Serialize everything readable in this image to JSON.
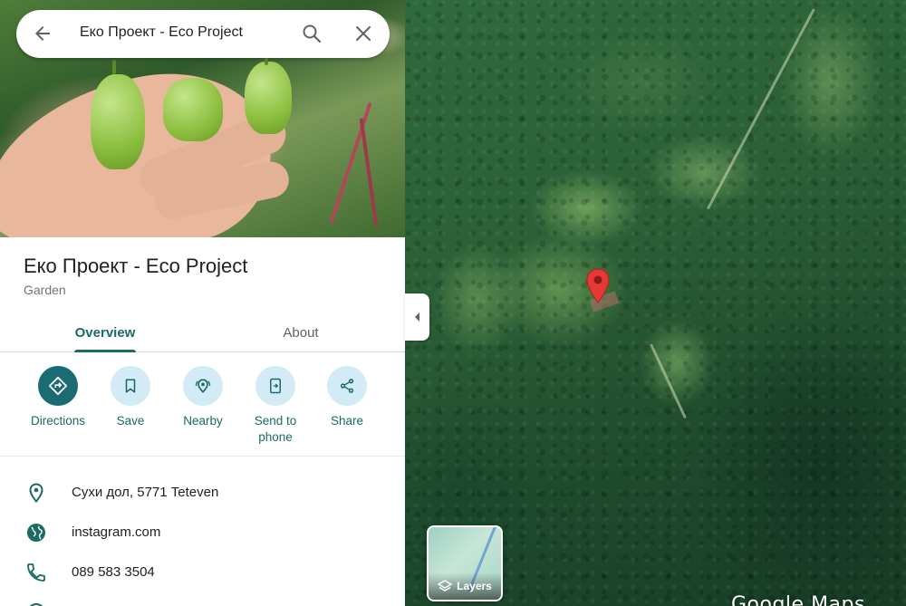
{
  "search": {
    "query": "Еко Проект - Eco Project"
  },
  "place": {
    "name": "Еко Проект - Eco Project",
    "category": "Garden"
  },
  "tabs": [
    {
      "label": "Overview",
      "active": true
    },
    {
      "label": "About",
      "active": false
    }
  ],
  "actions": [
    {
      "label": "Directions",
      "icon": "directions-icon"
    },
    {
      "label": "Save",
      "icon": "bookmark-icon"
    },
    {
      "label": "Nearby",
      "icon": "nearby-icon"
    },
    {
      "label": "Send to phone",
      "icon": "send-to-phone-icon"
    },
    {
      "label": "Share",
      "icon": "share-icon"
    }
  ],
  "info": {
    "address": "Сухи дол, 5771 Teteven",
    "website": "instagram.com",
    "phone": "089 583 3504"
  },
  "map": {
    "layers_label": "Layers",
    "logo": "Google Maps"
  },
  "colors": {
    "accent": "#1a6b63",
    "action_bg": "#d2ebf4",
    "pin": "#e53935"
  }
}
